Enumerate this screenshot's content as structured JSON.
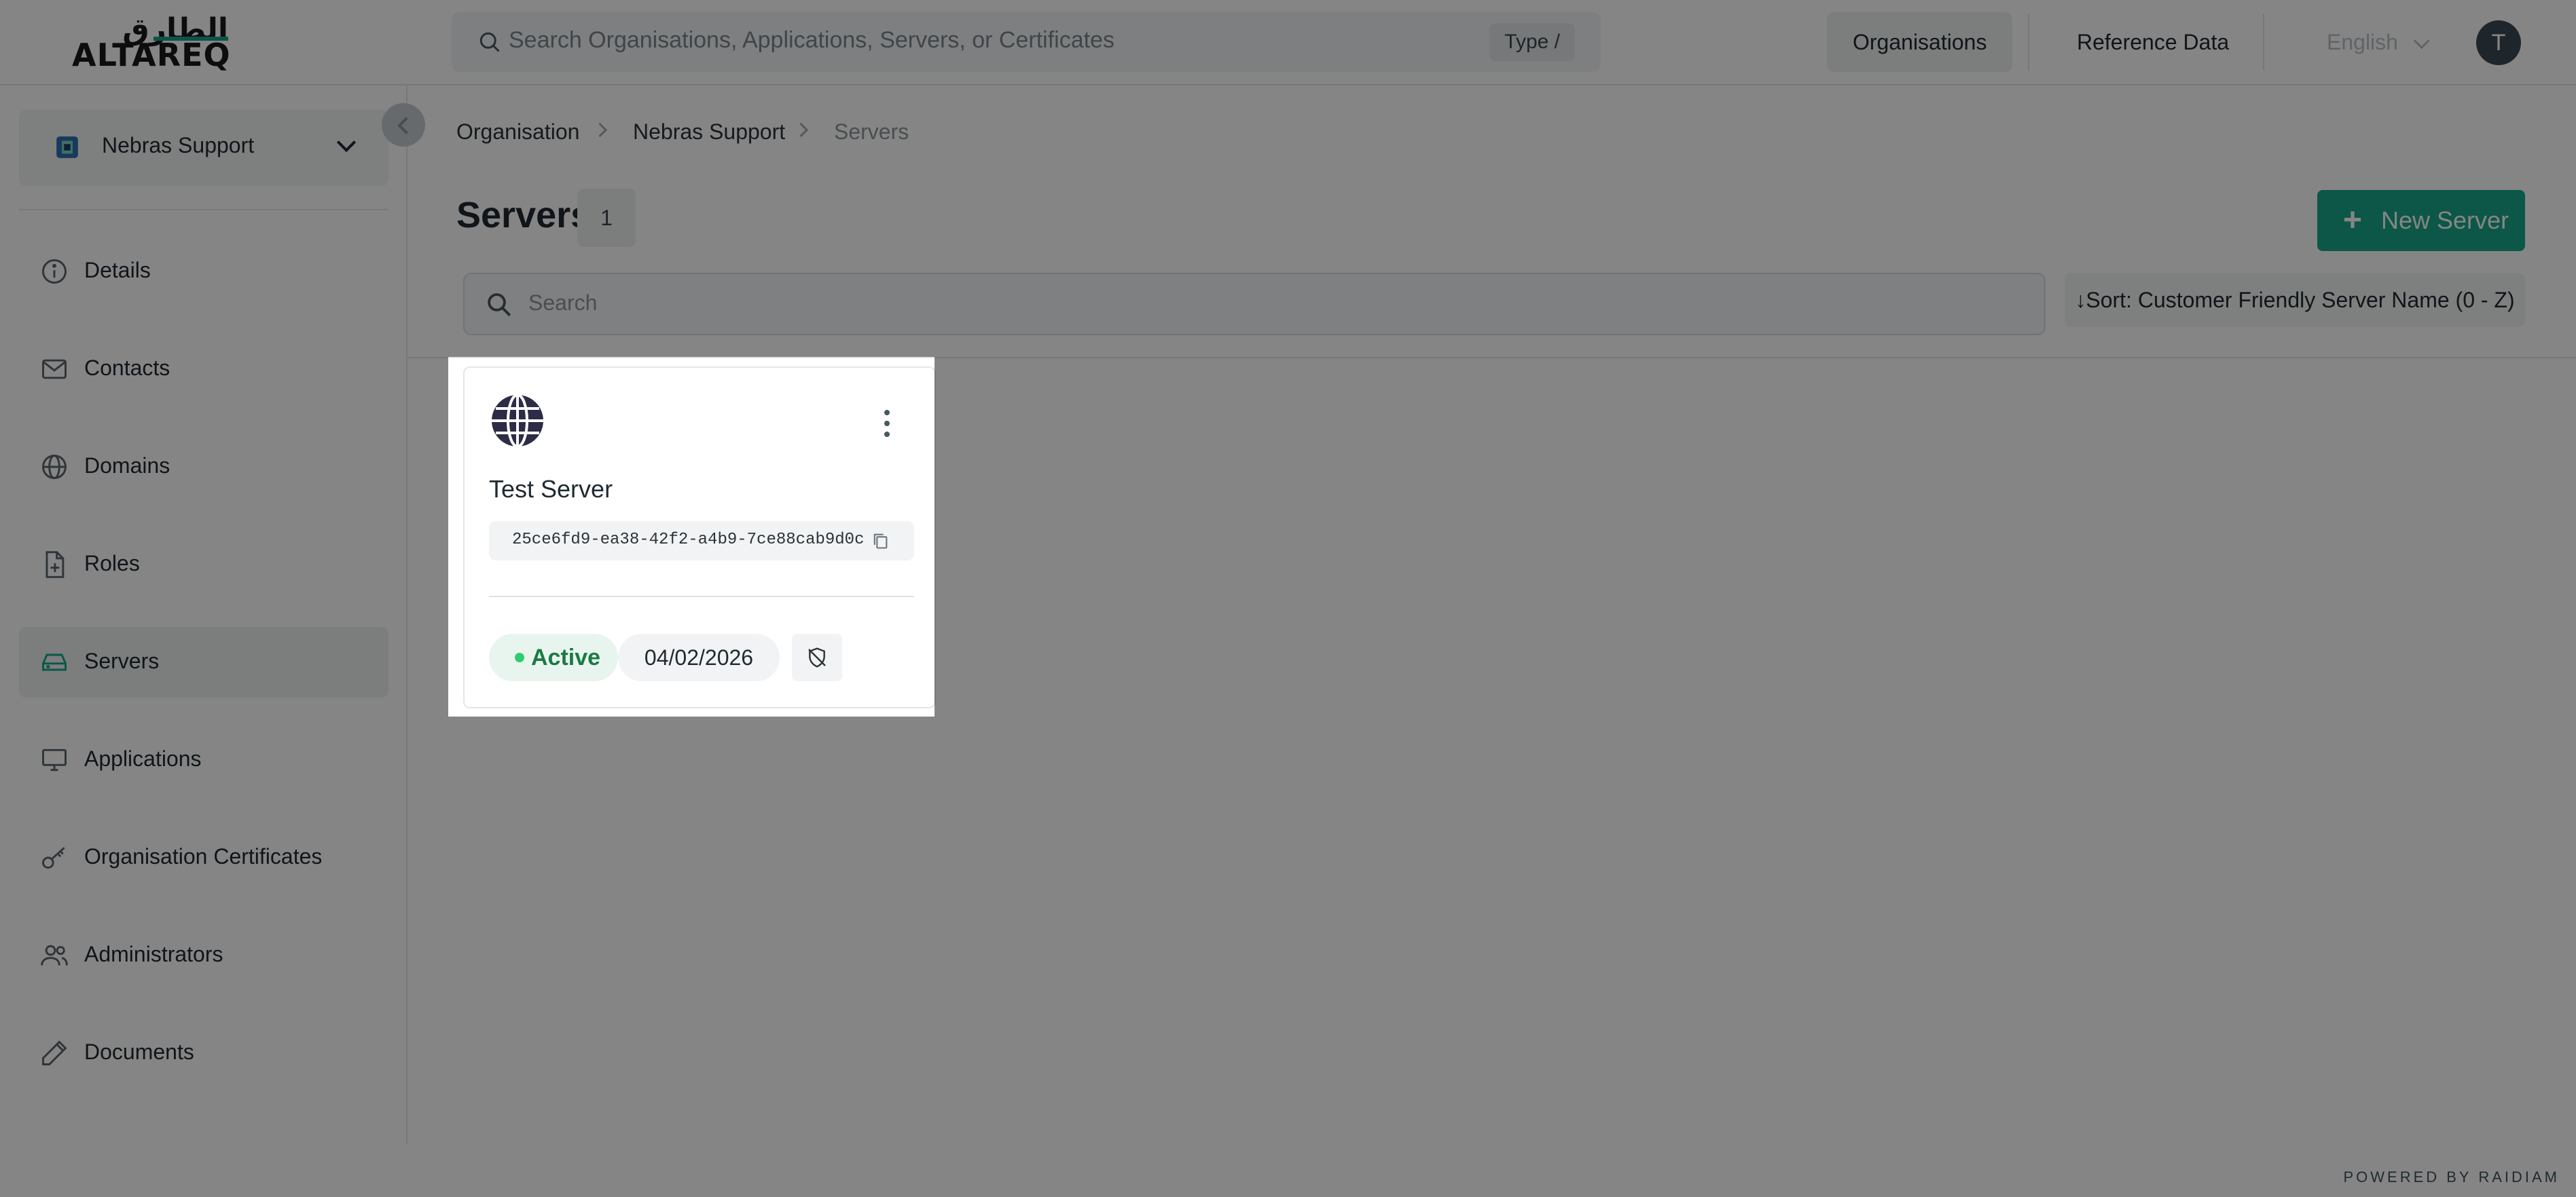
{
  "logo": {
    "arabic": "الطارق",
    "latin": "ALTAREQ"
  },
  "topbar": {
    "search_placeholder": "Search Organisations, Applications, Servers, or Certificates",
    "search_shortcut": "Type /",
    "nav": [
      "Organisations",
      "Reference Data"
    ],
    "language": "English",
    "avatar_initial": "T"
  },
  "sidebar": {
    "org_name": "Nebras Support",
    "items": [
      {
        "label": "Details",
        "icon": "info-icon"
      },
      {
        "label": "Contacts",
        "icon": "mail-icon"
      },
      {
        "label": "Domains",
        "icon": "globe-icon"
      },
      {
        "label": "Roles",
        "icon": "file-plus-icon"
      },
      {
        "label": "Servers",
        "icon": "server-icon",
        "active": true
      },
      {
        "label": "Applications",
        "icon": "monitor-icon"
      },
      {
        "label": "Organisation Certificates",
        "icon": "key-icon"
      },
      {
        "label": "Administrators",
        "icon": "users-icon"
      },
      {
        "label": "Documents",
        "icon": "pen-icon"
      }
    ]
  },
  "breadcrumb": [
    "Organisation",
    "Nebras Support",
    "Servers"
  ],
  "page": {
    "title": "Servers",
    "count": "1",
    "new_button": "New Server",
    "search_placeholder": "Search",
    "sort_label": "Sort: Customer Friendly Server Name (0 - Z)"
  },
  "servers": [
    {
      "name": "Test Server",
      "id": "25ce6fd9-ea38-42f2-a4b9-7ce88cab9d0c",
      "status": "Active",
      "date": "04/02/2026"
    }
  ],
  "footer": {
    "powered": "POWERED BY RAIDIAM"
  },
  "colors": {
    "brand": "#17a888",
    "status_active": "#2ecc71",
    "overlay": "rgba(0,0,0,0.48)"
  }
}
